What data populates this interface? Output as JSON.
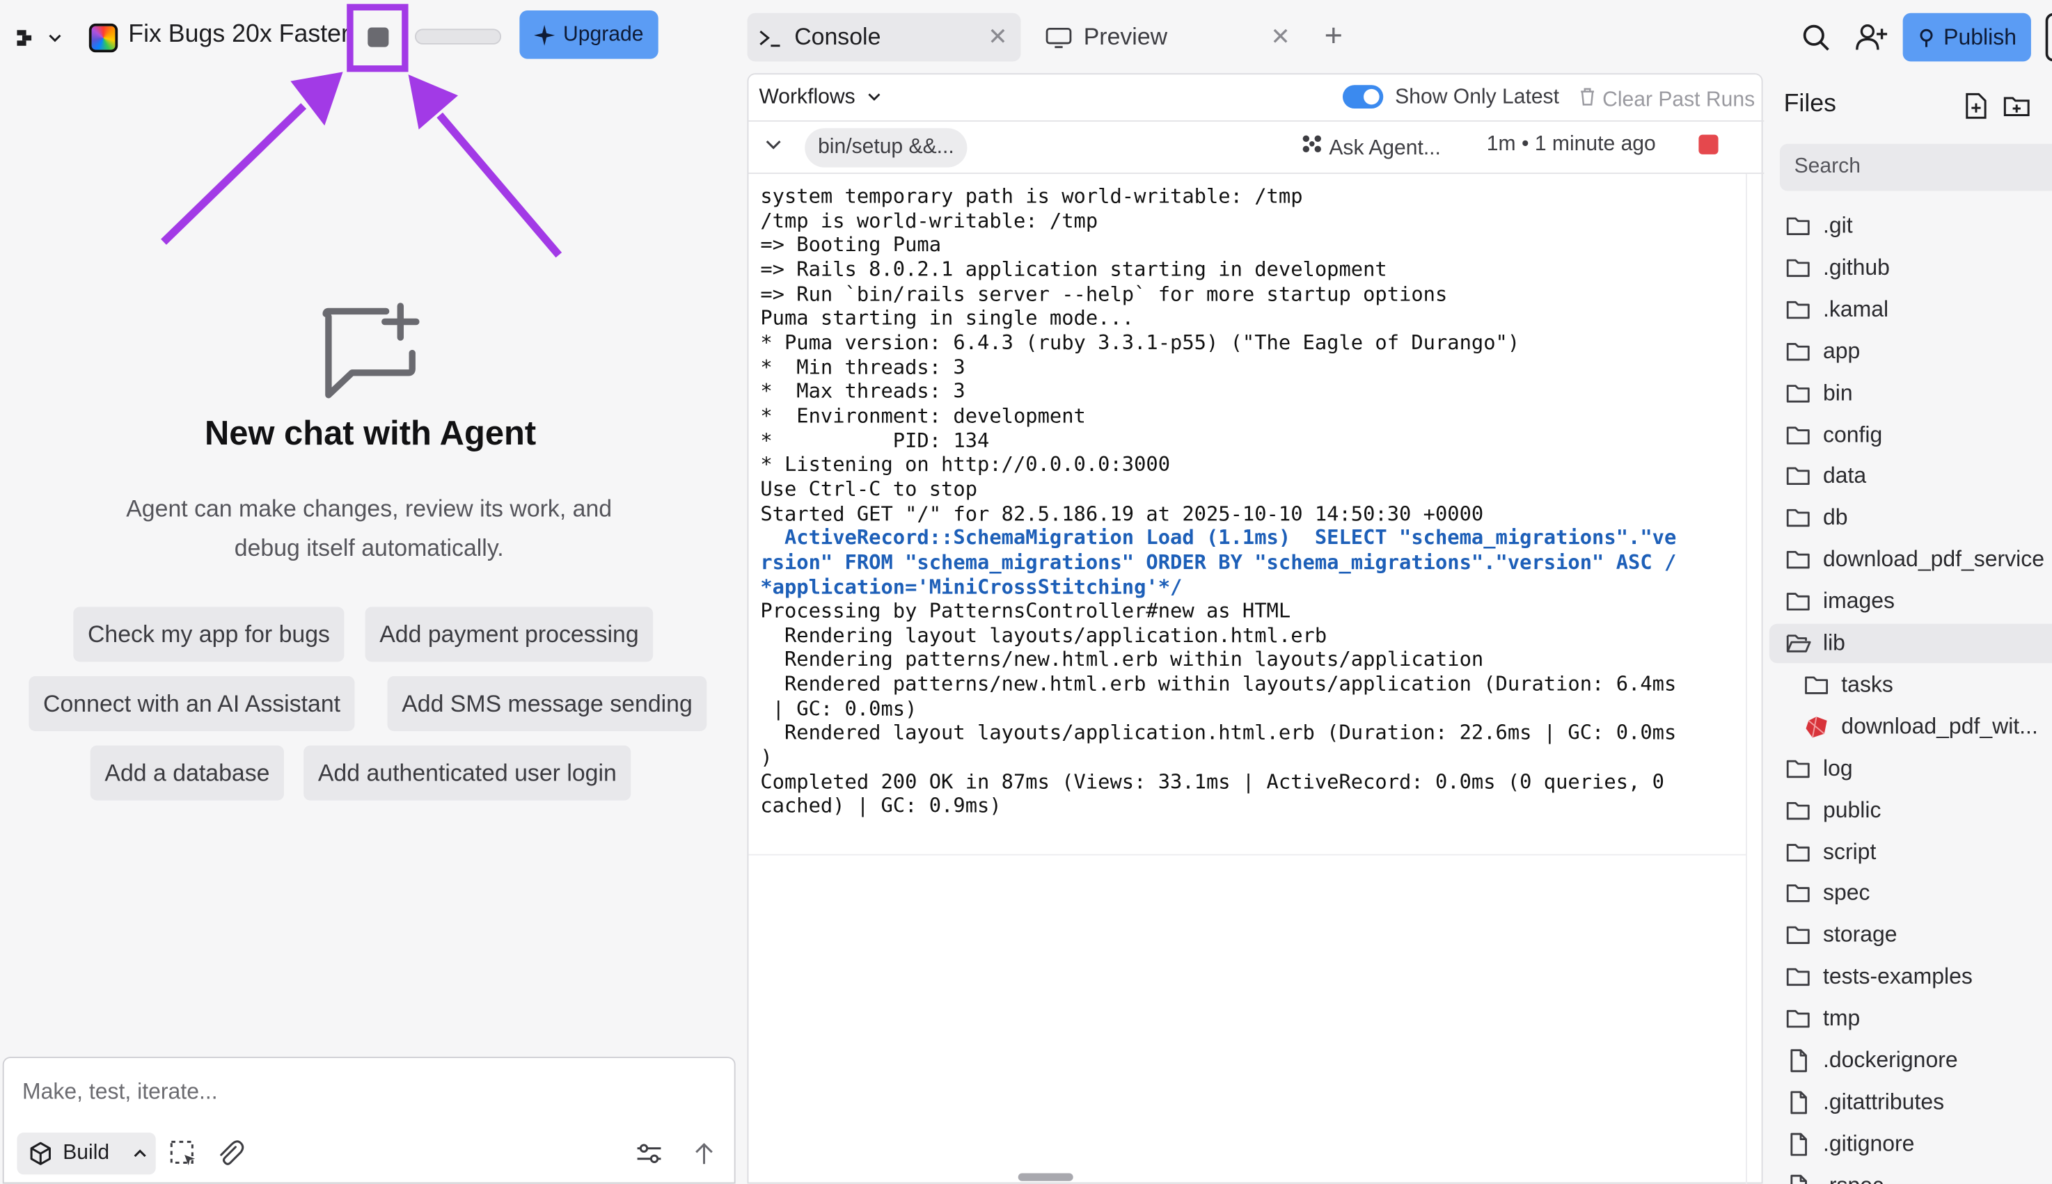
{
  "header": {
    "app_title": "Fix Bugs 20x Faster",
    "upgrade_label": "Upgrade",
    "publish_label": "Publish",
    "progress": 0
  },
  "tabs": [
    {
      "label": "Console",
      "active": true
    },
    {
      "label": "Preview",
      "active": false
    }
  ],
  "agent": {
    "title": "New chat with Agent",
    "description": "Agent can make changes, review its work, and debug itself automatically.",
    "suggestions": [
      "Check my app for bugs",
      "Add payment processing",
      "Connect with an AI Assistant",
      "Add SMS message sending",
      "Add a database",
      "Add authenticated user login"
    ],
    "composer_placeholder": "Make, test, iterate...",
    "mode_label": "Build"
  },
  "console": {
    "workflows_label": "Workflows",
    "show_only_latest_label": "Show Only Latest",
    "show_only_latest": true,
    "clear_past_runs_label": "Clear Past Runs",
    "run_command": "bin/setup &&...",
    "ask_agent_label": "Ask Agent...",
    "run_time": "1m • 1 minute ago",
    "log_lines": [
      {
        "text": "system temporary path is world-writable: /tmp",
        "sql": false
      },
      {
        "text": "/tmp is world-writable: /tmp",
        "sql": false
      },
      {
        "text": "=> Booting Puma",
        "sql": false
      },
      {
        "text": "=> Rails 8.0.2.1 application starting in development",
        "sql": false
      },
      {
        "text": "=> Run `bin/rails server --help` for more startup options",
        "sql": false
      },
      {
        "text": "Puma starting in single mode...",
        "sql": false
      },
      {
        "text": "* Puma version: 6.4.3 (ruby 3.3.1-p55) (\"The Eagle of Durango\")",
        "sql": false
      },
      {
        "text": "*  Min threads: 3",
        "sql": false
      },
      {
        "text": "*  Max threads: 3",
        "sql": false
      },
      {
        "text": "*  Environment: development",
        "sql": false
      },
      {
        "text": "*          PID: 134",
        "sql": false
      },
      {
        "text": "* Listening on http://0.0.0.0:3000",
        "sql": false
      },
      {
        "text": "Use Ctrl-C to stop",
        "sql": false
      },
      {
        "text": "Started GET \"/\" for 82.5.186.19 at 2025-10-10 14:50:30 +0000",
        "sql": false
      },
      {
        "text": "  ActiveRecord::SchemaMigration Load (1.1ms)  SELECT \"schema_migrations\".\"ve",
        "sql": true
      },
      {
        "text": "rsion\" FROM \"schema_migrations\" ORDER BY \"schema_migrations\".\"version\" ASC /",
        "sql": true
      },
      {
        "text": "*application='MiniCrossStitching'*/",
        "sql": true
      },
      {
        "text": "Processing by PatternsController#new as HTML",
        "sql": false
      },
      {
        "text": "  Rendering layout layouts/application.html.erb",
        "sql": false
      },
      {
        "text": "  Rendering patterns/new.html.erb within layouts/application",
        "sql": false
      },
      {
        "text": "  Rendered patterns/new.html.erb within layouts/application (Duration: 6.4ms",
        "sql": false
      },
      {
        "text": " | GC: 0.0ms)",
        "sql": false
      },
      {
        "text": "  Rendered layout layouts/application.html.erb (Duration: 22.6ms | GC: 0.0ms",
        "sql": false
      },
      {
        "text": ")",
        "sql": false
      },
      {
        "text": "Completed 200 OK in 87ms (Views: 33.1ms | ActiveRecord: 0.0ms (0 queries, 0",
        "sql": false
      },
      {
        "text": "cached) | GC: 0.9ms)",
        "sql": false
      }
    ]
  },
  "files": {
    "title": "Files",
    "search_placeholder": "Search",
    "items": [
      {
        "name": ".git",
        "type": "folder",
        "indent": 0,
        "selected": false
      },
      {
        "name": ".github",
        "type": "folder",
        "indent": 0,
        "selected": false
      },
      {
        "name": ".kamal",
        "type": "folder",
        "indent": 0,
        "selected": false
      },
      {
        "name": "app",
        "type": "folder",
        "indent": 0,
        "selected": false
      },
      {
        "name": "bin",
        "type": "folder",
        "indent": 0,
        "selected": false
      },
      {
        "name": "config",
        "type": "folder",
        "indent": 0,
        "selected": false
      },
      {
        "name": "data",
        "type": "folder",
        "indent": 0,
        "selected": false
      },
      {
        "name": "db",
        "type": "folder",
        "indent": 0,
        "selected": false
      },
      {
        "name": "download_pdf_service",
        "type": "folder",
        "indent": 0,
        "selected": false
      },
      {
        "name": "images",
        "type": "folder",
        "indent": 0,
        "selected": false
      },
      {
        "name": "lib",
        "type": "folder-open",
        "indent": 0,
        "selected": true
      },
      {
        "name": "tasks",
        "type": "folder",
        "indent": 1,
        "selected": false
      },
      {
        "name": "download_pdf_wit...",
        "type": "ruby",
        "indent": 1,
        "selected": false
      },
      {
        "name": "log",
        "type": "folder",
        "indent": 0,
        "selected": false
      },
      {
        "name": "public",
        "type": "folder",
        "indent": 0,
        "selected": false
      },
      {
        "name": "script",
        "type": "folder",
        "indent": 0,
        "selected": false
      },
      {
        "name": "spec",
        "type": "folder",
        "indent": 0,
        "selected": false
      },
      {
        "name": "storage",
        "type": "folder",
        "indent": 0,
        "selected": false
      },
      {
        "name": "tests-examples",
        "type": "folder",
        "indent": 0,
        "selected": false
      },
      {
        "name": "tmp",
        "type": "folder",
        "indent": 0,
        "selected": false
      },
      {
        "name": ".dockerignore",
        "type": "file",
        "indent": 0,
        "selected": false
      },
      {
        "name": ".gitattributes",
        "type": "file",
        "indent": 0,
        "selected": false
      },
      {
        "name": ".gitignore",
        "type": "file",
        "indent": 0,
        "selected": false
      },
      {
        "name": ".rspec",
        "type": "file",
        "indent": 0,
        "selected": false
      }
    ]
  },
  "colors": {
    "accent_blue": "#5b9cf4",
    "annotation_purple": "#a23ae6",
    "stop_red": "#e5484d",
    "sql_blue": "#1d5fb8"
  },
  "icons": [
    "replit-logo-icon",
    "chevron-down-icon",
    "stop-icon",
    "sparkle-icon",
    "terminal-icon",
    "monitor-icon",
    "close-icon",
    "plus-icon",
    "search-icon",
    "add-user-icon",
    "publish-icon",
    "new-chat-icon",
    "cube-icon",
    "chevron-up-icon",
    "select-element-icon",
    "paperclip-icon",
    "settings-sliders-icon",
    "arrow-up-icon",
    "trash-icon",
    "agent-icon",
    "new-file-icon",
    "new-folder-icon",
    "folder-icon",
    "folder-open-icon",
    "file-icon",
    "ruby-icon"
  ]
}
